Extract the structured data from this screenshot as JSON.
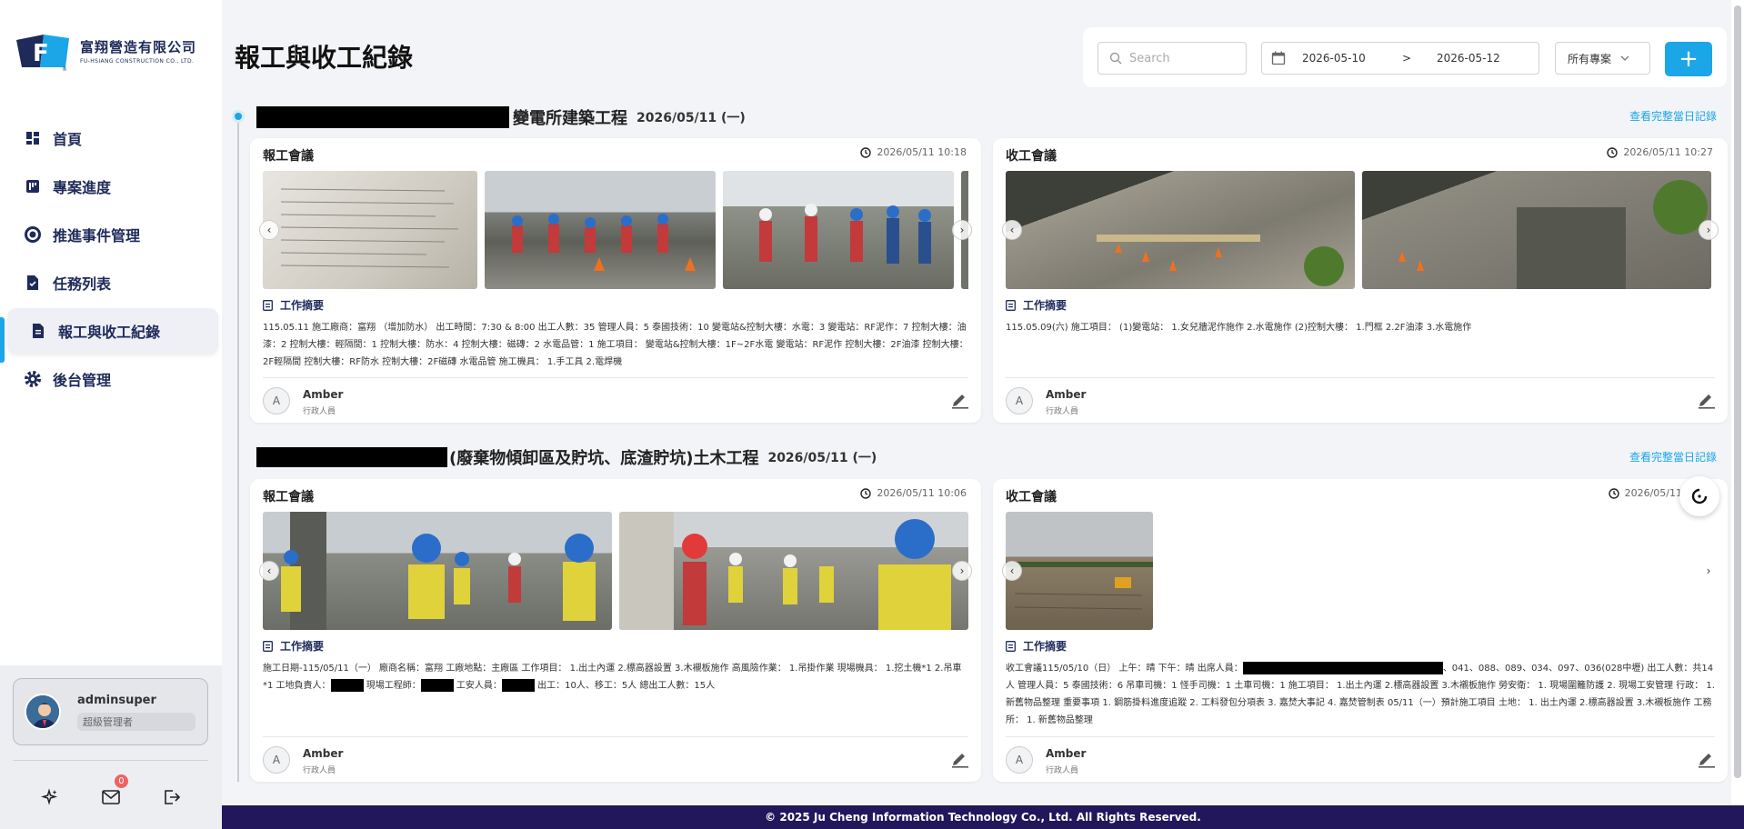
{
  "brand": {
    "name_zh": "富翔營造有限公司",
    "name_en": "FU-HSIANG CONSTRUCTION CO., LTD.",
    "accent": "#1ba6e8",
    "navy": "#1e2a5a"
  },
  "sidebar": {
    "items": [
      {
        "label": "首頁",
        "icon": "dashboard-icon"
      },
      {
        "label": "專案進度",
        "icon": "kanban-icon"
      },
      {
        "label": "推進事件管理",
        "icon": "target-icon"
      },
      {
        "label": "任務列表",
        "icon": "task-file-icon"
      },
      {
        "label": "報工與收工紀錄",
        "icon": "document-icon",
        "active": true
      },
      {
        "label": "後台管理",
        "icon": "gear-icon"
      }
    ],
    "user": {
      "name": "adminsuper",
      "role": "超級管理者"
    },
    "notifications": "0"
  },
  "header": {
    "title": "報工與收工紀錄",
    "search_placeholder": "Search",
    "date_from": "2026-05-10",
    "date_sep": ">",
    "date_to": "2026-05-12",
    "project_filter": "所有專案",
    "add_label": "+"
  },
  "full_day_link": "查看完整當日記錄",
  "projects": [
    {
      "name": "變電所建築工程",
      "date": "2026/05/11 (一)",
      "start": {
        "title": "報工會議",
        "time": "2026/05/11 10:18",
        "summary_heading": "工作摘要",
        "summary": "115.05.11 施工廠商：富翔 （增加防水） 出工時間：7:30 & 8:00 出工人數：35 管理人員：5 泰國技術：10 變電站&控制大樓：水電：3 變電站：RF泥作：7 控制大樓：油漆：2 控制大樓：輕隔間：1 控制大樓：防水：4 控制大樓：磁磚：2 水電品管：1 施工項目： 變電站&控制大樓：1F~2F水電 變電站：RF泥作 控制大樓：2F油漆 控制大樓：2F輕隔間 控制大樓：RF防水 控制大樓：2F磁磚 水電品管 施工機具： 1.手工具 2.電焊機",
        "author": "Amber",
        "author_role": "行政人員",
        "initial": "A"
      },
      "end": {
        "title": "收工會議",
        "time": "2026/05/11 10:27",
        "summary_heading": "工作摘要",
        "summary": "115.05.09(六) 施工項目： (1)變電站： 1.女兒牆泥作施作 2.水電施作 (2)控制大樓： 1.門框 2.2F油漆 3.水電施作",
        "author": "Amber",
        "author_role": "行政人員",
        "initial": "A"
      }
    },
    {
      "name": "(廢棄物傾卸區及貯坑、底渣貯坑)土木工程",
      "date": "2026/05/11 (一)",
      "start": {
        "title": "報工會議",
        "time": "2026/05/11 10:06",
        "summary_heading": "工作摘要",
        "summary_a": "施工日期-115/05/11（一） 廠商名稱：富翔 工廠地點：主廠區 工作項目： 1.出土內運 2.標高器設置 3.木襯板施作 高風險作業： 1.吊掛作業 現場機具： 1.挖土機*1 2.吊車*1 工地負責人：",
        "summary_b": " 現場工程師：",
        "summary_c": " 工安人員：",
        "summary_d": " 出工：10人、移工：5人 總出工人數：15人",
        "author": "Amber",
        "author_role": "行政人員",
        "initial": "A"
      },
      "end": {
        "title": "收工會議",
        "time": "2026/05/11",
        "summary_heading": "工作摘要",
        "summary_a": "收工會議115/05/10（日） 上午：晴 下午：晴 出席人員：",
        "summary_b": "、041、088、089、034、097、036(028中壢) 出工人數：共14人 管理人員：5 泰國技術：6 吊車司機：1 怪手司機：1 土車司機：1 施工項目： 1.出土內運 2.標高器設置 3.木襯板施作 勞安衛： 1. 現場圍籬防護 2. 現場工安管理 行政： 1. 新舊物品整理 重要事項 1. 鋼筋掛料進度追蹤 2. 工料發包分項表 3. 嘉焚大事記 4. 嘉焚管制表 05/11（一）預計施工項目 土地： 1. 出土內運 2.標高器設置 3.木襯板施作 工務所： 1. 新舊物品整理",
        "author": "Amber",
        "author_role": "行政人員",
        "initial": "A"
      }
    }
  ],
  "footer": "© 2025 Ju Cheng Information Technology Co., Ltd. All Rights Reserved."
}
